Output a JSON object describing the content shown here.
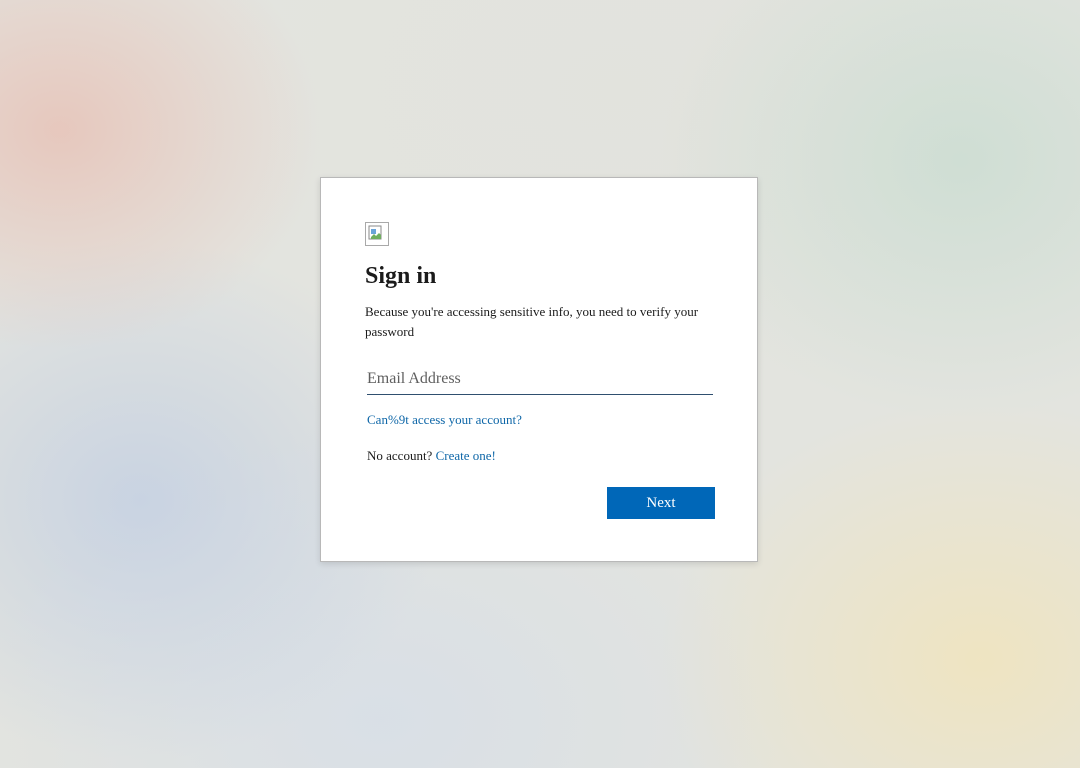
{
  "signin": {
    "title": "Sign in",
    "description": "Because you're accessing sensitive info, you need to verify your password",
    "email": {
      "value": "",
      "placeholder": "Email Address"
    },
    "cant_access_link": "Can%9t access your account?",
    "no_account_text": "No account?",
    "create_link": "Create one!",
    "next_label": "Next"
  },
  "colors": {
    "accent": "#0067b8",
    "link": "#0f67a8"
  },
  "icons": {
    "logo": "broken-image-icon"
  }
}
